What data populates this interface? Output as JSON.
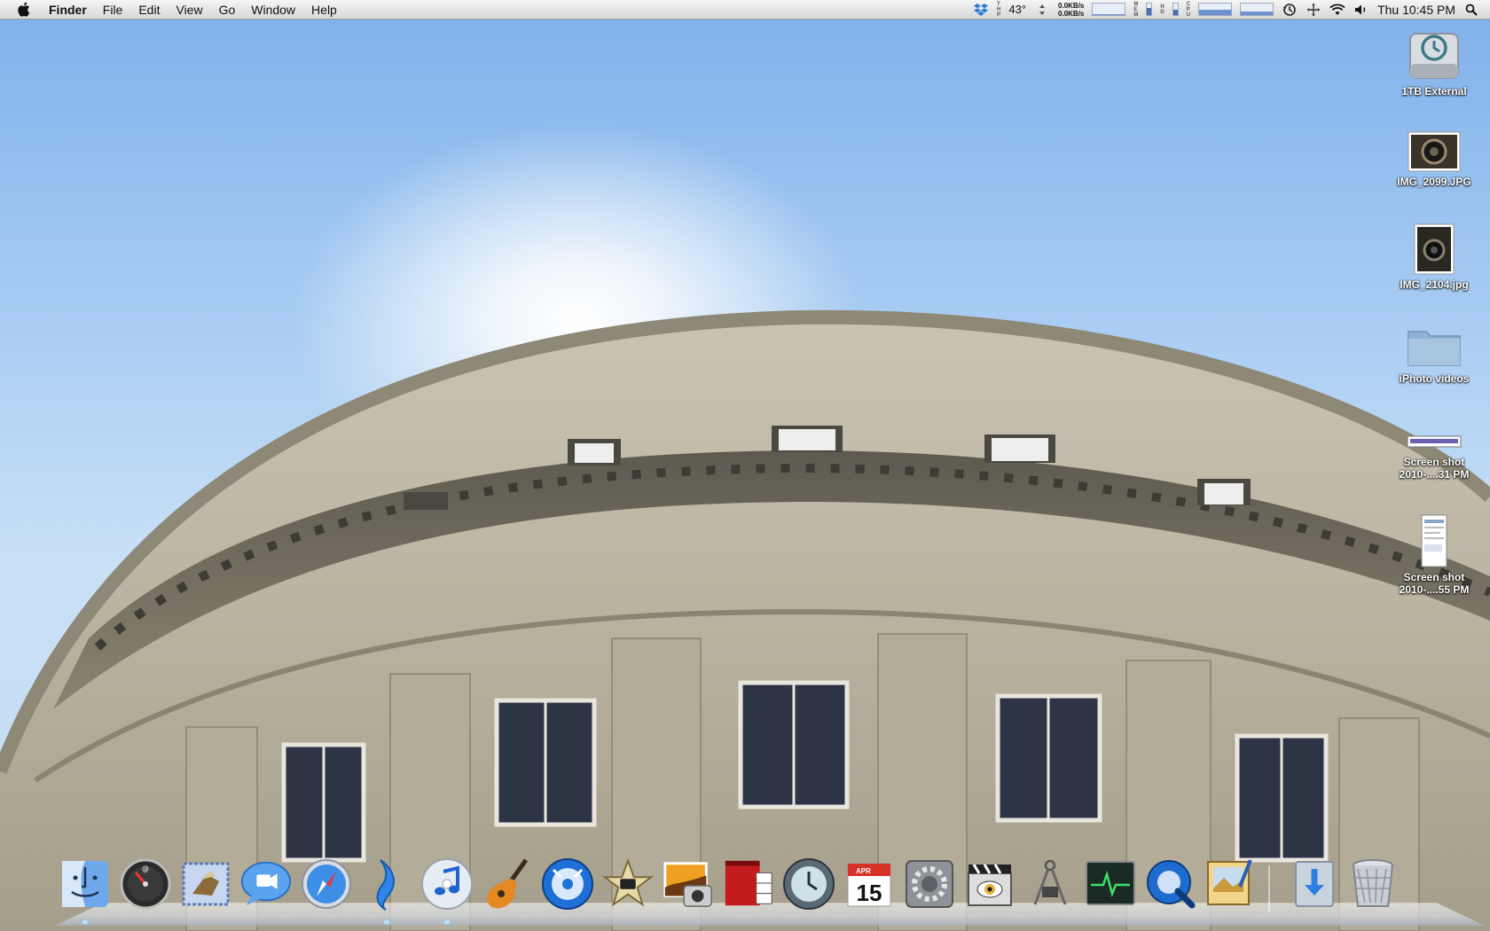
{
  "menubar": {
    "app_name": "Finder",
    "menus": [
      "File",
      "Edit",
      "View",
      "Go",
      "Window",
      "Help"
    ],
    "status": {
      "temperature": "43°",
      "net_up": "0.0KB/s",
      "net_down": "0.0KB/s",
      "clock": "Thu 10:45 PM"
    }
  },
  "desktop_items": [
    {
      "label": "1TB External",
      "icon": "time-machine-drive-icon"
    },
    {
      "label": "IMG_2099.JPG",
      "icon": "image-thumbnail-icon"
    },
    {
      "label": "IMG_2104.jpg",
      "icon": "image-thumbnail-icon"
    },
    {
      "label": "iPhoto videos",
      "icon": "folder-icon"
    },
    {
      "label": "Screen shot\n2010-....31 PM",
      "icon": "screenshot-thumbnail-icon"
    },
    {
      "label": "Screen shot\n2010-....55 PM",
      "icon": "document-thumbnail-icon"
    }
  ],
  "dock": {
    "items": [
      {
        "name": "finder",
        "icon": "finder-icon",
        "running": true
      },
      {
        "name": "dashboard",
        "icon": "dashboard-icon",
        "running": false
      },
      {
        "name": "mail",
        "icon": "mail-icon",
        "running": false
      },
      {
        "name": "ichat",
        "icon": "ichat-icon",
        "running": false
      },
      {
        "name": "safari",
        "icon": "safari-icon",
        "running": false
      },
      {
        "name": "unknown-app",
        "icon": "blue-ribbon-icon",
        "running": true
      },
      {
        "name": "itunes",
        "icon": "itunes-icon",
        "running": true
      },
      {
        "name": "garageband",
        "icon": "guitar-icon",
        "running": false
      },
      {
        "name": "idvd",
        "icon": "dvd-icon",
        "running": false
      },
      {
        "name": "imovie",
        "icon": "star-icon",
        "running": false
      },
      {
        "name": "iphoto",
        "icon": "iphoto-icon",
        "running": false
      },
      {
        "name": "photo-booth",
        "icon": "photo-booth-icon",
        "running": false
      },
      {
        "name": "time-machine",
        "icon": "time-machine-icon",
        "running": false
      },
      {
        "name": "ical",
        "icon": "calendar-icon",
        "running": false,
        "month": "APR",
        "day": "15"
      },
      {
        "name": "system-preferences",
        "icon": "gears-icon",
        "running": false
      },
      {
        "name": "front-row",
        "icon": "clapper-icon",
        "running": false
      },
      {
        "name": "directory-utility",
        "icon": "compass-icon",
        "running": false
      },
      {
        "name": "activity-monitor",
        "icon": "heartbeat-icon",
        "running": false
      },
      {
        "name": "quicktime",
        "icon": "quicktime-icon",
        "running": false
      },
      {
        "name": "preview",
        "icon": "preview-icon",
        "running": false
      },
      {
        "name": "downloads",
        "icon": "downloads-stack-icon",
        "running": false
      },
      {
        "name": "trash",
        "icon": "trash-icon",
        "running": false
      }
    ]
  },
  "colors": {
    "accent_blue": "#4a6fb5",
    "dock_indicator": "#bde3ff"
  },
  "levels": {
    "net_graph_fill": 0.1,
    "mem_bar_fill": 0.6,
    "hd_bar_fill": 0.5,
    "cpu_graph_fill": 0.45,
    "cpu2_graph_fill": 0.3
  }
}
